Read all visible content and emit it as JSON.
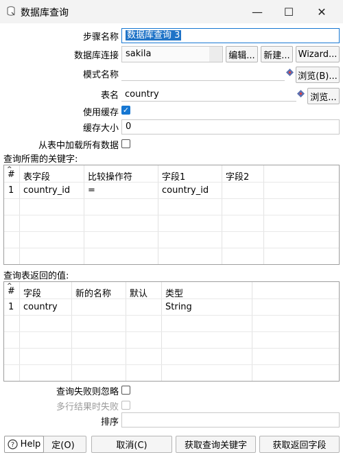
{
  "window": {
    "title": "数据库查询",
    "minimize": "—",
    "maximize": "☐",
    "close": "✕"
  },
  "form": {
    "step_name_label": "步骤名称",
    "step_name_value": "数据库查询 3",
    "db_conn_label": "数据库连接",
    "db_conn_value": "sakila",
    "edit_btn": "编辑...",
    "new_btn": "新建...",
    "wizard_btn": "Wizard...",
    "schema_label": "模式名称",
    "schema_value": "",
    "browse_schema_btn": "浏览(B)...",
    "table_label": "表名",
    "table_value": "country",
    "browse_table_btn": "浏览...",
    "use_cache_label": "使用缓存",
    "cache_size_label": "缓存大小",
    "cache_size_value": "0",
    "load_all_label": "从表中加载所有数据"
  },
  "keys_table": {
    "section_label": "查询所需的关键字:",
    "headers": [
      "#",
      "表字段",
      "比较操作符",
      "字段1",
      "字段2"
    ],
    "rows": [
      [
        "1",
        "country_id",
        "=",
        "country_id",
        ""
      ]
    ]
  },
  "values_table": {
    "section_label": "查询表返回的值:",
    "headers": [
      "#",
      "字段",
      "新的名称",
      "默认",
      "类型"
    ],
    "rows": [
      [
        "1",
        "country",
        "",
        "",
        "String"
      ]
    ]
  },
  "footer": {
    "fail_ignore_label": "查询失败则忽略",
    "multi_fail_label": "多行结果时失败",
    "order_label": "排序",
    "order_value": ""
  },
  "buttons": {
    "help": "Help",
    "ok_partial": "定(O)",
    "cancel": "取消(C)",
    "get_keys": "获取查询关键字",
    "get_return": "获取返回字段"
  },
  "colors": {
    "accent": "#1677d2",
    "selection": "#1f73c7"
  }
}
